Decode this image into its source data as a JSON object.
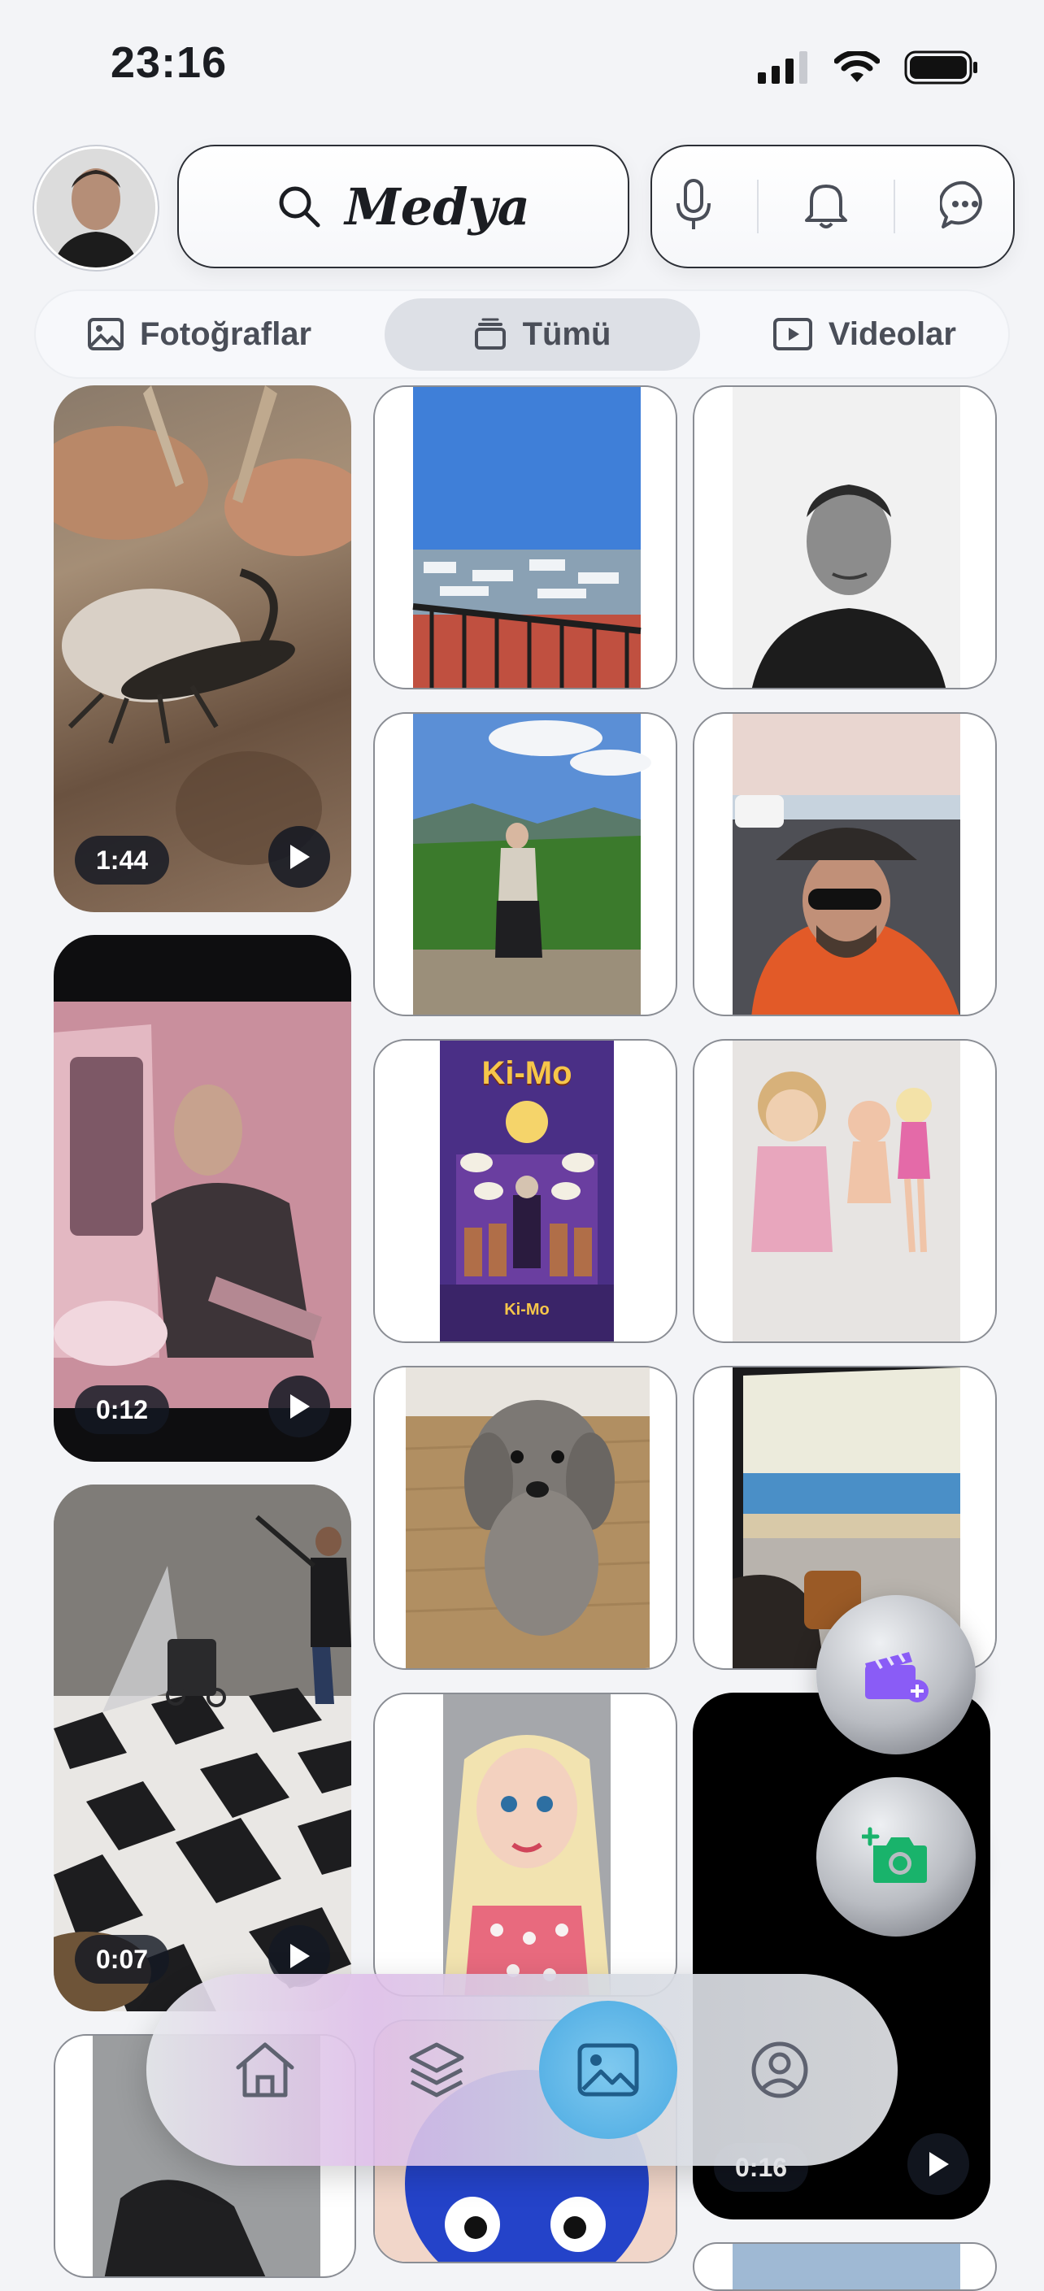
{
  "status_bar": {
    "time": "23:16"
  },
  "header": {
    "title": "Medya"
  },
  "tabs": [
    {
      "label": "Fotoğraflar",
      "active": false
    },
    {
      "label": "Tümü",
      "active": true
    },
    {
      "label": "Videolar",
      "active": false
    }
  ],
  "media": {
    "videos": [
      {
        "duration": "1:44",
        "subject": "scorpion"
      },
      {
        "duration": "0:12",
        "subject": "man in car"
      },
      {
        "duration": "0:07",
        "subject": "pressure washing floor"
      },
      {
        "duration": "0:16",
        "subject": "dark clip"
      }
    ],
    "poster": {
      "title": "Ki-Mo",
      "footer": "Ki-Mo"
    }
  },
  "bottom_nav": [
    {
      "icon": "home-icon",
      "active": false
    },
    {
      "icon": "layers-icon",
      "active": false
    },
    {
      "icon": "gallery-icon",
      "active": true
    },
    {
      "icon": "profile-icon",
      "active": false
    }
  ],
  "colors": {
    "accent_purple": "#8a5cf6",
    "accent_green": "#19b36b",
    "nav_active": "#5ab3e6"
  }
}
